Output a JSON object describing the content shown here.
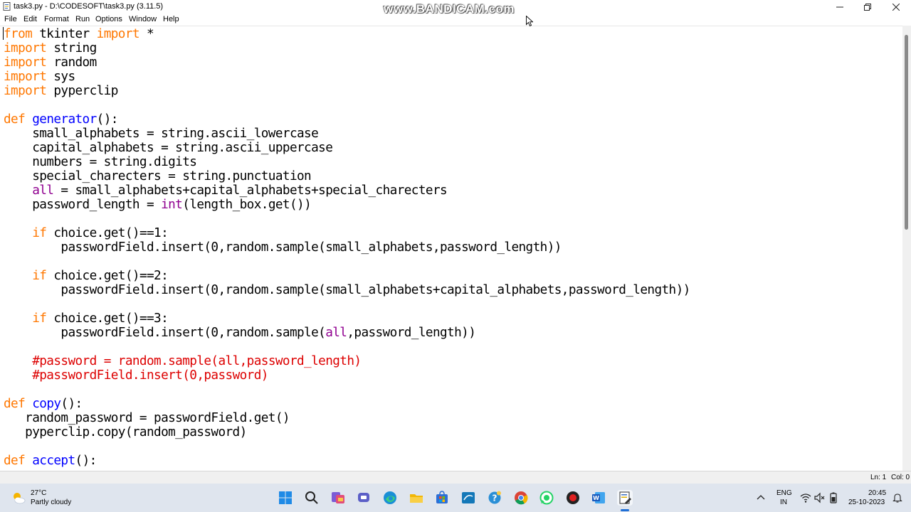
{
  "window": {
    "title": "task3.py - D:\\CODESOFT\\task3.py (3.11.5)",
    "watermark": "www.BANDICAM.com"
  },
  "menu": [
    "File",
    "Edit",
    "Format",
    "Run",
    "Options",
    "Window",
    "Help"
  ],
  "code_lines": [
    [
      {
        "t": "from",
        "c": "kw"
      },
      {
        "t": " tkinter "
      },
      {
        "t": "import",
        "c": "kw"
      },
      {
        "t": " *"
      }
    ],
    [
      {
        "t": "import",
        "c": "kw"
      },
      {
        "t": " string"
      }
    ],
    [
      {
        "t": "import",
        "c": "kw"
      },
      {
        "t": " random"
      }
    ],
    [
      {
        "t": "import",
        "c": "kw"
      },
      {
        "t": " sys"
      }
    ],
    [
      {
        "t": "import",
        "c": "kw"
      },
      {
        "t": " pyperclip"
      }
    ],
    [],
    [
      {
        "t": "def",
        "c": "kw"
      },
      {
        "t": " "
      },
      {
        "t": "generator",
        "c": "fn"
      },
      {
        "t": "():"
      }
    ],
    [
      {
        "t": "    small_alphabets = string.ascii_lowercase"
      }
    ],
    [
      {
        "t": "    capital_alphabets = string.ascii_uppercase"
      }
    ],
    [
      {
        "t": "    numbers = string.digits"
      }
    ],
    [
      {
        "t": "    special_charecters = string.punctuation"
      }
    ],
    [
      {
        "t": "    "
      },
      {
        "t": "all",
        "c": "bi"
      },
      {
        "t": " = small_alphabets+capital_alphabets+special_charecters"
      }
    ],
    [
      {
        "t": "    password_length = "
      },
      {
        "t": "int",
        "c": "bi"
      },
      {
        "t": "(length_box.get())"
      }
    ],
    [],
    [
      {
        "t": "    "
      },
      {
        "t": "if",
        "c": "kw"
      },
      {
        "t": " choice.get()==1:"
      }
    ],
    [
      {
        "t": "        passwordField.insert(0,random.sample(small_alphabets,password_length))"
      }
    ],
    [],
    [
      {
        "t": "    "
      },
      {
        "t": "if",
        "c": "kw"
      },
      {
        "t": " choice.get()==2:"
      }
    ],
    [
      {
        "t": "        passwordField.insert(0,random.sample(small_alphabets+capital_alphabets,password_length))"
      }
    ],
    [],
    [
      {
        "t": "    "
      },
      {
        "t": "if",
        "c": "kw"
      },
      {
        "t": " choice.get()==3:"
      }
    ],
    [
      {
        "t": "        passwordField.insert(0,random.sample("
      },
      {
        "t": "all",
        "c": "bi"
      },
      {
        "t": ",password_length))"
      }
    ],
    [],
    [
      {
        "t": "    "
      },
      {
        "t": "#password = random.sample(all,password_length)",
        "c": "cm"
      }
    ],
    [
      {
        "t": "    "
      },
      {
        "t": "#passwordField.insert(0,password)",
        "c": "cm"
      }
    ],
    [],
    [
      {
        "t": "def",
        "c": "kw"
      },
      {
        "t": " "
      },
      {
        "t": "copy",
        "c": "fn"
      },
      {
        "t": "():"
      }
    ],
    [
      {
        "t": "   random_password = passwordField.get()"
      }
    ],
    [
      {
        "t": "   pyperclip.copy(random_password)"
      }
    ],
    [],
    [
      {
        "t": "def",
        "c": "kw"
      },
      {
        "t": " "
      },
      {
        "t": "accept",
        "c": "fn"
      },
      {
        "t": "():"
      }
    ]
  ],
  "status": {
    "line": "Ln: 1",
    "col": "Col: 0"
  },
  "taskbar": {
    "weather_temp": "27°C",
    "weather_desc": "Partly cloudy",
    "language_line1": "ENG",
    "language_line2": "IN",
    "time": "20:45",
    "date": "25-10-2023"
  },
  "colors": {
    "keyword": "#ff7700",
    "function": "#0000ff",
    "builtin": "#900090",
    "comment": "#dd0000",
    "taskbar_bg": "#dfe5ee"
  }
}
